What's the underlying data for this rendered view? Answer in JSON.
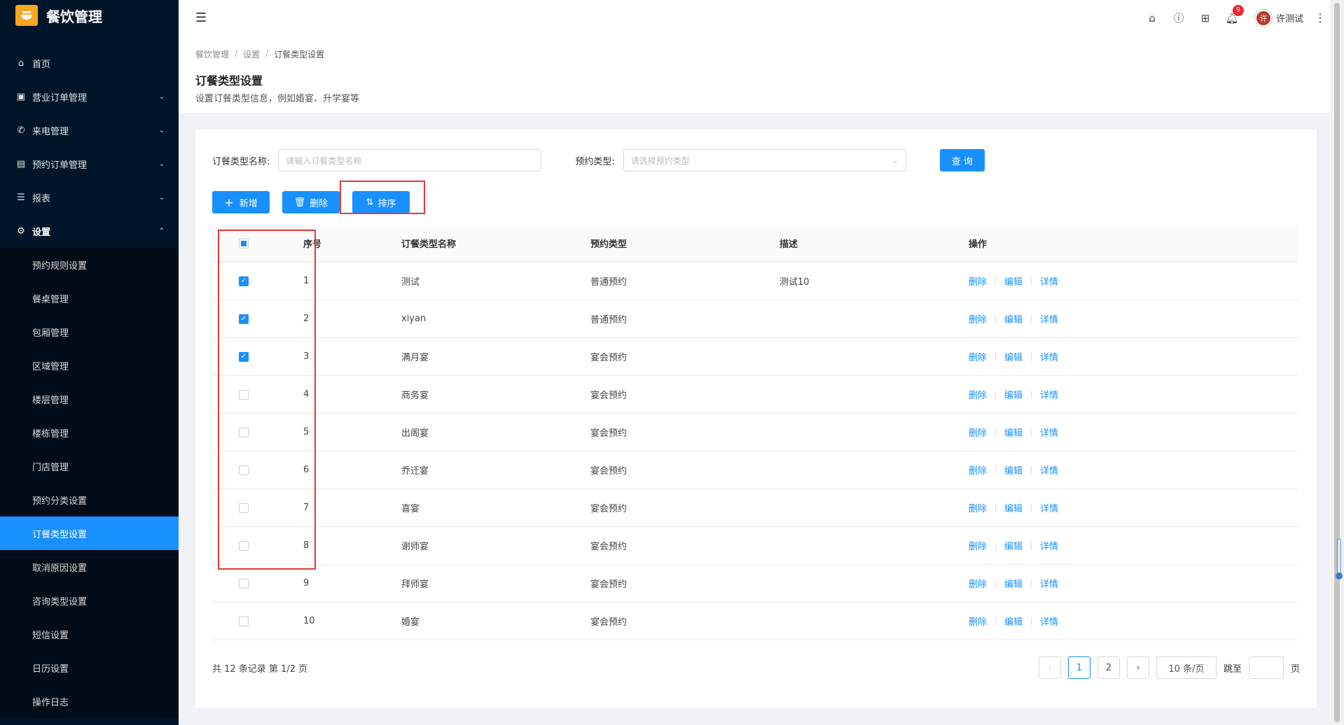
{
  "app": {
    "title": "餐饮管理"
  },
  "sidebar": {
    "menu": [
      {
        "label": "首页",
        "icon": "⌂",
        "chevron": ""
      },
      {
        "label": "营业订单管理",
        "icon": "▣",
        "chevron": "⌄"
      },
      {
        "label": "来电管理",
        "icon": "✆",
        "chevron": "⌄"
      },
      {
        "label": "预约订单管理",
        "icon": "▤",
        "chevron": "⌄"
      },
      {
        "label": "报表",
        "icon": "☰",
        "chevron": "⌄"
      },
      {
        "label": "设置",
        "icon": "⚙",
        "chevron": "⌃"
      }
    ],
    "submenu": [
      "预约规则设置",
      "餐桌管理",
      "包厢管理",
      "区域管理",
      "楼层管理",
      "楼栋管理",
      "门店管理",
      "预约分类设置",
      "订餐类型设置",
      "取消原因设置",
      "咨询类型设置",
      "短信设置",
      "日历设置",
      "操作日志"
    ],
    "active_sub": "订餐类型设置"
  },
  "header": {
    "notification_count": "9",
    "user_name": "许测试",
    "avatar_text": "许"
  },
  "breadcrumb": {
    "item1": "餐饮管理",
    "item2": "设置",
    "item3": "订餐类型设置",
    "sep": "/"
  },
  "page": {
    "title": "订餐类型设置",
    "desc": "设置订餐类型信息，例如婚宴、升学宴等"
  },
  "filter": {
    "name_label": "订餐类型名称:",
    "name_placeholder": "请输入订餐类型名称",
    "type_label": "预约类型:",
    "type_placeholder": "请选择预约类型",
    "query": "查 询"
  },
  "actions": {
    "add": "新增",
    "delete": "删除",
    "sort": "排序"
  },
  "table": {
    "headers": {
      "no": "序号",
      "name": "订餐类型名称",
      "type": "预约类型",
      "desc": "描述",
      "op": "操作"
    },
    "rows": [
      {
        "no": "1",
        "name": "测试",
        "type": "普通预约",
        "desc": "测试10",
        "checked": true
      },
      {
        "no": "2",
        "name": "xiyan",
        "type": "普通预约",
        "desc": "",
        "checked": true
      },
      {
        "no": "3",
        "name": "满月宴",
        "type": "宴会预约",
        "desc": "",
        "checked": true
      },
      {
        "no": "4",
        "name": "商务宴",
        "type": "宴会预约",
        "desc": "",
        "checked": false
      },
      {
        "no": "5",
        "name": "出阁宴",
        "type": "宴会预约",
        "desc": "",
        "checked": false
      },
      {
        "no": "6",
        "name": "乔迁宴",
        "type": "宴会预约",
        "desc": "",
        "checked": false
      },
      {
        "no": "7",
        "name": "喜宴",
        "type": "宴会预约",
        "desc": "",
        "checked": false
      },
      {
        "no": "8",
        "name": "谢师宴",
        "type": "宴会预约",
        "desc": "",
        "checked": false
      },
      {
        "no": "9",
        "name": "拜师宴",
        "type": "宴会预约",
        "desc": "",
        "checked": false
      },
      {
        "no": "10",
        "name": "婚宴",
        "type": "宴会预约",
        "desc": "",
        "checked": false
      }
    ],
    "ops": {
      "delete": "删除",
      "edit": "编辑",
      "detail": "详情"
    }
  },
  "pagination": {
    "total_text": "共 12 条记录 第 1/2 页",
    "prev": "‹",
    "next": "›",
    "pages": [
      "1",
      "2"
    ],
    "page_size": "10 条/页",
    "jump_label": "跳至",
    "page_unit": "页"
  },
  "colors": {
    "sidebar_bg": "#001529",
    "accent": "#1890ff",
    "highlight": "#e53935",
    "logo": "#f5a623"
  }
}
